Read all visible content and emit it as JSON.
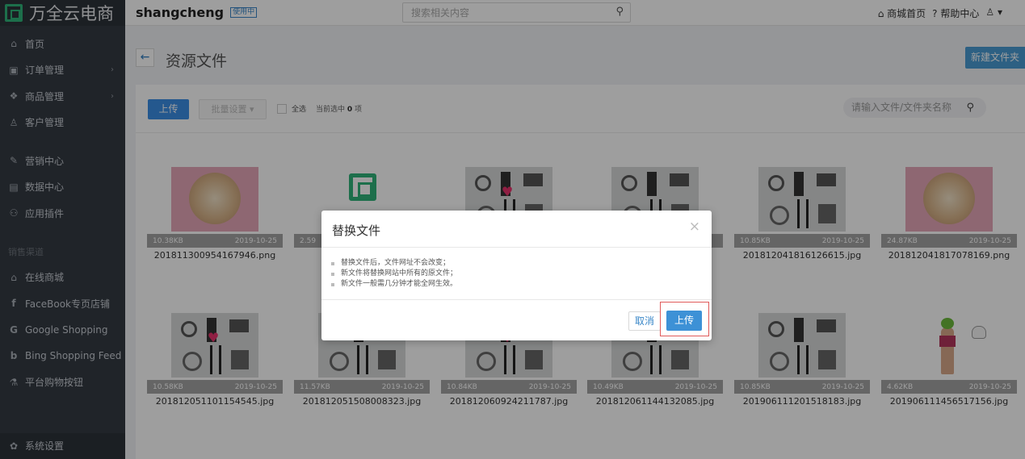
{
  "brand": {
    "logo_text": "万全云电商"
  },
  "sidebar": {
    "items": [
      {
        "label": "首页",
        "icon": "home-icon",
        "has_arrow": false
      },
      {
        "label": "订单管理",
        "icon": "order-icon",
        "has_arrow": true
      },
      {
        "label": "商品管理",
        "icon": "goods-icon",
        "has_arrow": true
      },
      {
        "label": "客户管理",
        "icon": "customer-icon",
        "has_arrow": false
      },
      {
        "label": "营销中心",
        "icon": "marketing-icon",
        "has_arrow": false
      },
      {
        "label": "数据中心",
        "icon": "data-icon",
        "has_arrow": false
      },
      {
        "label": "应用插件",
        "icon": "plugin-icon",
        "has_arrow": false
      }
    ],
    "channel_header": "销售渠道",
    "channels": [
      {
        "label": "在线商城",
        "icon": "store-icon"
      },
      {
        "label": "FaceBook专页店铺",
        "icon": "facebook-icon"
      },
      {
        "label": "Google Shopping",
        "icon": "google-icon"
      },
      {
        "label": "Bing Shopping Feed",
        "icon": "bing-icon"
      },
      {
        "label": "平台购物按钮",
        "icon": "cart-button-icon"
      }
    ],
    "settings": {
      "label": "系统设置",
      "icon": "gear-icon"
    }
  },
  "topbar": {
    "store_name": "shangcheng",
    "trial_badge": "使用中",
    "search_placeholder": "搜索相关内容",
    "links": {
      "home": "商城首页",
      "help": "帮助中心"
    }
  },
  "page": {
    "title": "资源文件",
    "new_folder": "新建文件夹"
  },
  "toolbar": {
    "upload": "上传",
    "batch": "批量设置",
    "select_all": "全选",
    "selected_prefix": "当前选中",
    "selected_count": "0",
    "selected_suffix": "项",
    "search_placeholder": "请输入文件/文件夹名称"
  },
  "files": [
    {
      "name": "201811300954167946.png",
      "size": "10.38KB",
      "date": "2019-10-25",
      "kind": "pink"
    },
    {
      "name": "20",
      "size": "2.59",
      "date": "",
      "kind": "logo"
    },
    {
      "name": "",
      "size": "",
      "date": "",
      "kind": "gear-heart"
    },
    {
      "name": "",
      "size": "",
      "date": "",
      "kind": "gear"
    },
    {
      "name": "201812041816126615.jpg",
      "size": "10.85KB",
      "date": "2019-10-25",
      "kind": "gear"
    },
    {
      "name": "201812041817078169.png",
      "size": "24.87KB",
      "date": "2019-10-25",
      "kind": "pink"
    },
    {
      "name": "201812051101154545.jpg",
      "size": "10.58KB",
      "date": "2019-10-25",
      "kind": "gear-heart"
    },
    {
      "name": "201812051508008323.jpg",
      "size": "11.57KB",
      "date": "2019-10-25",
      "kind": "gear"
    },
    {
      "name": "201812060924211787.jpg",
      "size": "10.84KB",
      "date": "2019-10-25",
      "kind": "gear-heart"
    },
    {
      "name": "201812061144132085.jpg",
      "size": "10.49KB",
      "date": "2019-10-25",
      "kind": "gear"
    },
    {
      "name": "201906111201518183.jpg",
      "size": "10.85KB",
      "date": "2019-10-25",
      "kind": "gear"
    },
    {
      "name": "201906111456517156.jpg",
      "size": "4.62KB",
      "date": "2019-10-25",
      "kind": "person"
    }
  ],
  "modal": {
    "title": "替换文件",
    "close": "×",
    "notes": [
      "替换文件后，文件网址不会改变；",
      "新文件将替换网站中所有的原文件；",
      "新文件一般需几分钟才能全网生效。"
    ],
    "cancel": "取消",
    "confirm": "上传"
  }
}
